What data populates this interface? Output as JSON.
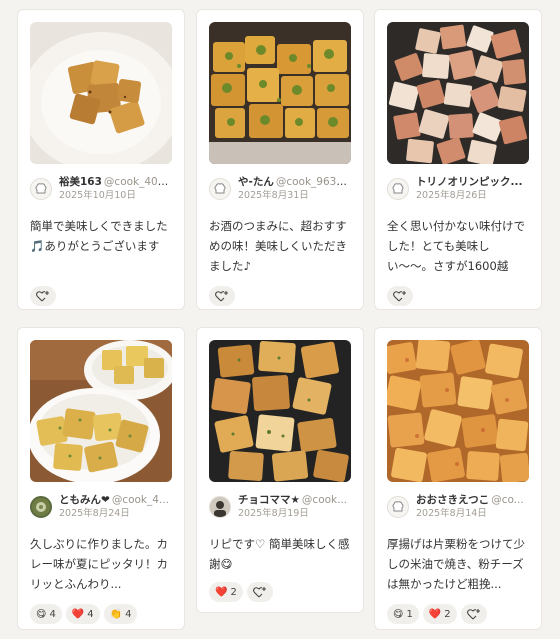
{
  "cards": [
    {
      "author_name": "裕美163",
      "author_handle": "@cook_402...",
      "date": "2025年10月10日",
      "comment": "簡単で美味しくできました🎵ありがとうございます",
      "photo_alt": "fried tofu cubes on white plate",
      "reactions": []
    },
    {
      "author_name": "や-たん",
      "author_handle": "@cook_9634...",
      "date": "2025年8月31日",
      "comment": "お酒のつまみに、超おすすめの味！美味しくいただきました♪",
      "photo_alt": "tofu cubes with green seasoning",
      "reactions": []
    },
    {
      "author_name": "トリノオリンピック...",
      "author_handle": "",
      "date": "2025年8月26日",
      "comment": "全く思い付かない味付けでした！とても美味しい〜〜。さすが1600越え...",
      "photo_alt": "fried tofu cubes on a plate",
      "reactions": []
    },
    {
      "author_name": "ともみん❤",
      "author_handle": "@cook_4...",
      "date": "2025年8月24日",
      "comment": "久しぶりに作りました。カレー味が夏にピッタリ！カリッとふんわり...",
      "photo_alt": "curry flavored tofu cubes in white bowl",
      "reactions": [
        {
          "icon": "😋",
          "count": "4"
        },
        {
          "icon": "❤️",
          "count": "4"
        },
        {
          "icon": "👏",
          "count": "4"
        }
      ]
    },
    {
      "author_name": "チョコママ★",
      "author_handle": "@cook...",
      "date": "2025年8月19日",
      "comment": "リピです♡ 簡単美味しく感謝😋",
      "photo_alt": "golden fried tofu cubes",
      "reactions": [
        {
          "icon": "❤️",
          "count": "2"
        }
      ]
    },
    {
      "author_name": "おおさきえつこ",
      "author_handle": "@co...",
      "date": "2025年8月14日",
      "comment": "厚揚げは片栗粉をつけて少しの米油で焼き、粉チーズは無かったけど粗挽...",
      "photo_alt": "crispy tofu cubes with seasoning",
      "reactions": [
        {
          "icon": "😋",
          "count": "1"
        },
        {
          "icon": "❤️",
          "count": "2"
        }
      ]
    }
  ]
}
